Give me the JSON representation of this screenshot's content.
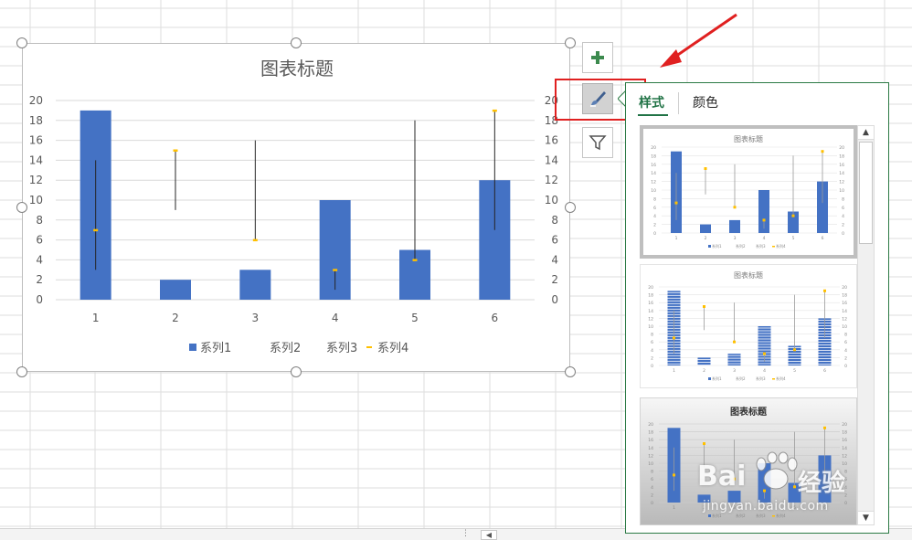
{
  "chart": {
    "title": "图表标题",
    "y_ticks": [
      "20",
      "18",
      "16",
      "14",
      "12",
      "10",
      "8",
      "6",
      "4",
      "2",
      "0"
    ],
    "y2_ticks": [
      "20",
      "18",
      "16",
      "14",
      "12",
      "10",
      "8",
      "6",
      "4",
      "2",
      "0"
    ],
    "legend": [
      "系列1",
      "系列2",
      "系列3",
      "系列4"
    ]
  },
  "chart_data": {
    "type": "bar",
    "title": "图表标题",
    "categories": [
      "1",
      "2",
      "3",
      "4",
      "5",
      "6"
    ],
    "ylim": [
      0,
      20
    ],
    "y2lim": [
      0,
      20
    ],
    "grid": true,
    "legend_position": "bottom",
    "series": [
      {
        "name": "系列1",
        "type": "bar",
        "axis": "primary",
        "color": "#4472c4",
        "values": [
          19,
          2,
          3,
          10,
          5,
          12
        ]
      },
      {
        "name": "系列2",
        "type": "line-high",
        "axis": "secondary",
        "color": "#404040",
        "values": [
          14,
          15,
          16,
          3,
          18,
          19
        ]
      },
      {
        "name": "系列3",
        "type": "line-low",
        "axis": "secondary",
        "color": "#404040",
        "values": [
          3,
          9,
          6,
          1,
          4,
          7
        ]
      },
      {
        "name": "系列4",
        "type": "marker",
        "axis": "secondary",
        "color": "#ffc000",
        "values": [
          7,
          15,
          6,
          3,
          4,
          19
        ]
      }
    ]
  },
  "side_buttons": {
    "add_icon": "plus-icon",
    "style_icon": "paintbrush-icon",
    "filter_icon": "funnel-icon"
  },
  "panel": {
    "tabs": [
      "样式",
      "颜色"
    ],
    "thumbnail_titles": [
      "图表标题",
      "图表标题",
      "图表标题"
    ]
  },
  "colors": {
    "accent": "#217346",
    "bar": "#4472c4",
    "marker": "#ffc000",
    "highlight": "#e02020"
  },
  "watermark": {
    "brand": "Bai",
    "brand_cn": "经验",
    "url": "jingyan.baidu.com"
  }
}
